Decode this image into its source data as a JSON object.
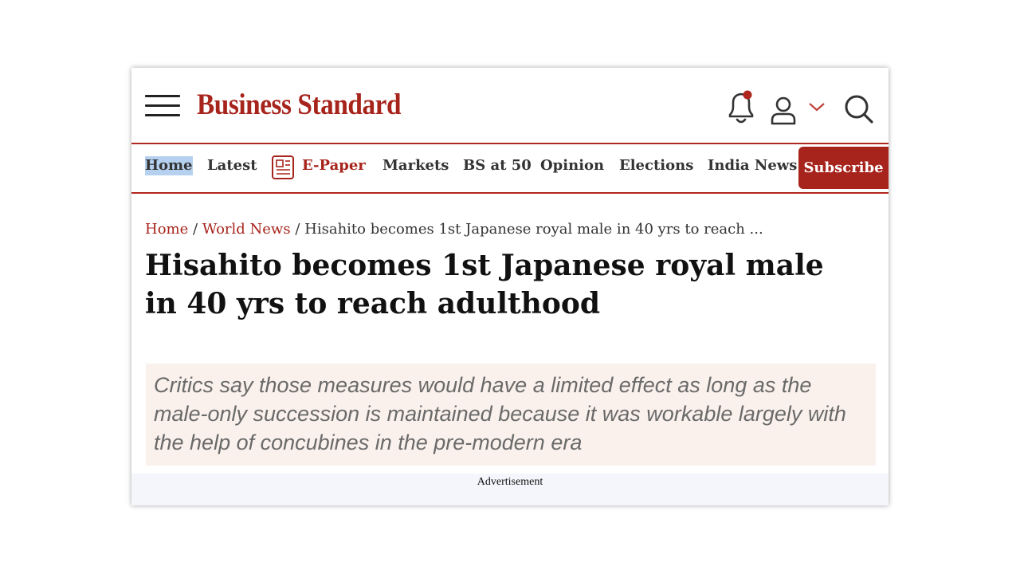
{
  "header": {
    "menu_icon": "hamburger-menu-icon",
    "logo_text": "Business Standard",
    "bell_icon": "notification-bell-icon",
    "user_icon": "user-account-icon",
    "chevron_icon": "chevron-down-icon",
    "search_icon": "search-icon"
  },
  "nav": {
    "items": [
      {
        "label": "Home"
      },
      {
        "label": "Latest"
      },
      {
        "label": "E-Paper",
        "icon": "newspaper-icon"
      },
      {
        "label": "Markets"
      },
      {
        "label": "BS at 50"
      },
      {
        "label": "Opinion"
      },
      {
        "label": "Elections"
      },
      {
        "label": "India News"
      }
    ],
    "subscribe_label": "Subscribe"
  },
  "breadcrumb": {
    "home": "Home",
    "section": "World News",
    "separator": "/",
    "current": "Hisahito becomes 1st Japanese royal male in 40 yrs to reach ..."
  },
  "article": {
    "headline": "Hisahito becomes 1st Japanese royal male in 40 yrs to reach adulthood",
    "summary": "Critics say those measures would have a limited effect as long as the male-only succession is maintained because it was workable largely with the help of concubines in the pre-modern era"
  },
  "ad": {
    "label": "Advertisement"
  },
  "colors": {
    "brand": "#a7241c",
    "summary_bg": "#faf1ec",
    "ad_bg": "#f4f6fb",
    "home_highlight": "#b5d1ef"
  }
}
